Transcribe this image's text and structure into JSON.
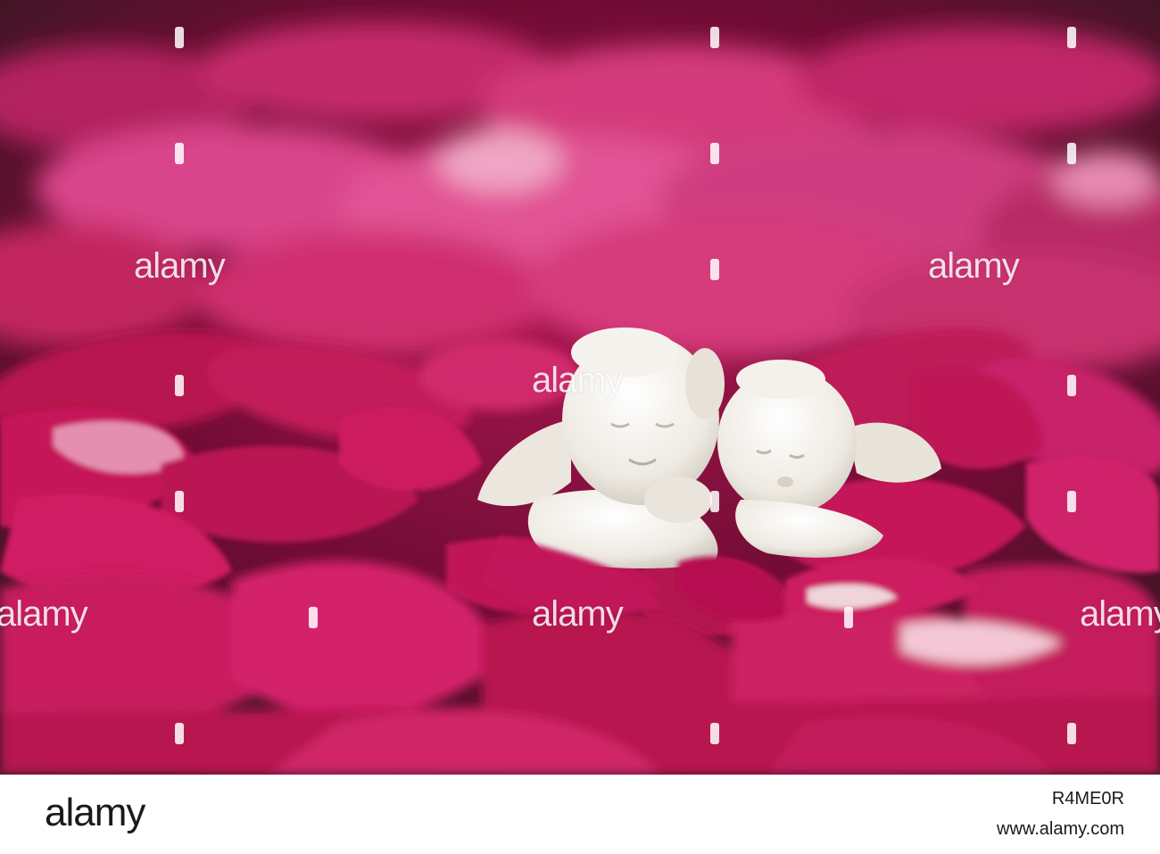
{
  "watermark": {
    "text": "alamy"
  },
  "footer": {
    "logo": "alamy",
    "image_id": "R4ME0R",
    "site": "www.alamy.com"
  },
  "colors": {
    "petal_main": "#c4145a",
    "petal_light": "#e0478a",
    "petal_dark": "#8c0a3e",
    "background_dark": "#3a1a22",
    "figurine": "#f2efe8"
  }
}
